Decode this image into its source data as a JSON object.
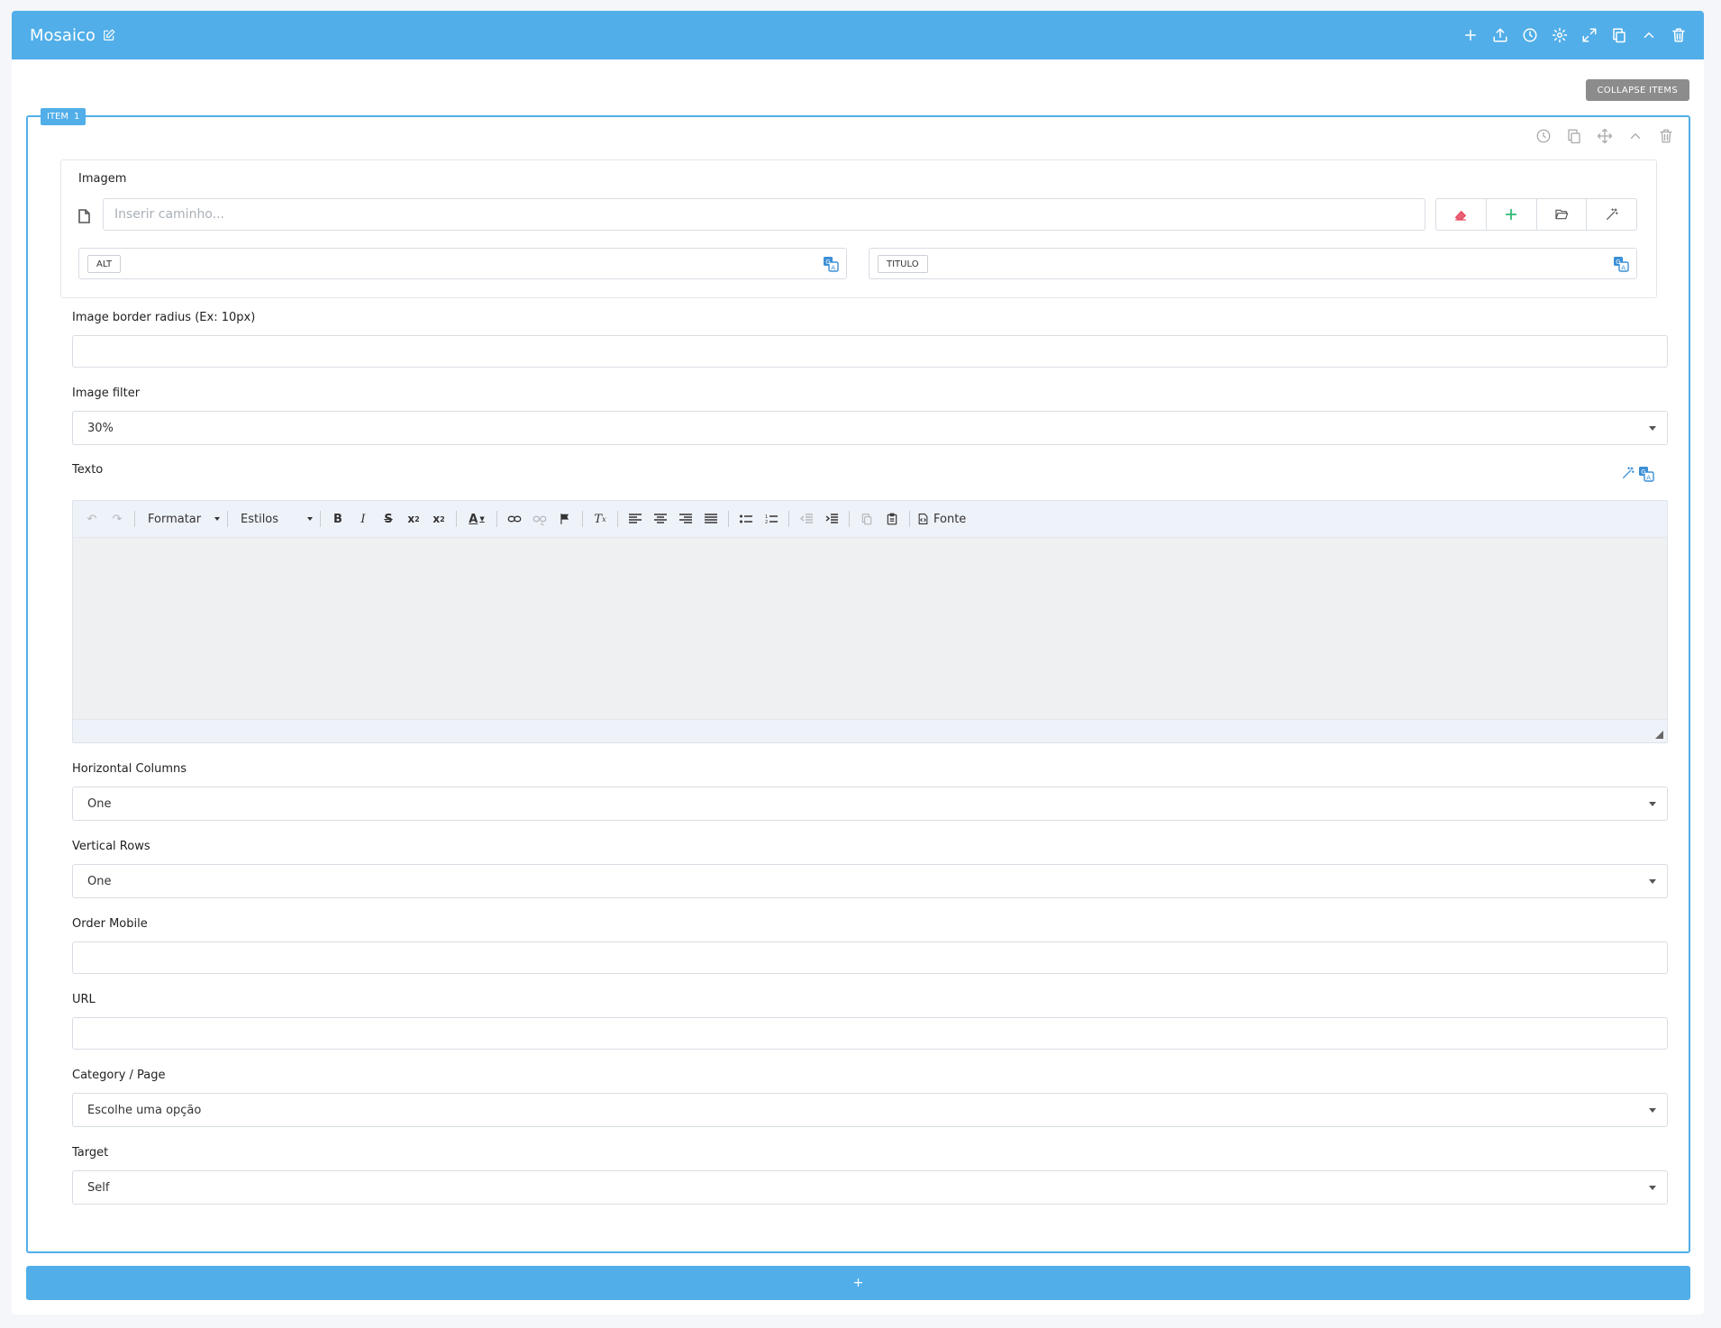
{
  "header": {
    "title": "Mosaico",
    "actions": [
      "plus-icon",
      "upload-icon",
      "clock-icon",
      "gear-icon",
      "expand-icon",
      "copy-icon",
      "chevron-up-icon",
      "trash-icon"
    ]
  },
  "collapse_label": "COLLAPSE ITEMS",
  "item": {
    "tag_label": "ITEM",
    "tag_number": "1",
    "actions": [
      "clock-icon",
      "copy-icon",
      "move-icon",
      "chevron-up-icon",
      "trash-icon"
    ],
    "image": {
      "label": "Imagem",
      "path_placeholder": "Inserir caminho...",
      "alt_tag": "ALT",
      "title_tag": "TITULO"
    },
    "fields": {
      "border_radius_label": "Image border radius (Ex: 10px)",
      "filter_label": "Image filter",
      "filter_value": "30%",
      "text_label": "Texto",
      "h_columns_label": "Horizontal Columns",
      "h_columns_value": "One",
      "v_rows_label": "Vertical Rows",
      "v_rows_value": "One",
      "order_mobile_label": "Order Mobile",
      "url_label": "URL",
      "category_label": "Category / Page",
      "category_value": "Escolhe uma opção",
      "target_label": "Target",
      "target_value": "Self"
    },
    "editor": {
      "format_label": "Formatar",
      "styles_label": "Estilos",
      "source_label": "Fonte"
    }
  },
  "add_label": "+",
  "colors": {
    "accent": "#51aee8",
    "delete": "#e8475f",
    "add": "#2eb872"
  }
}
